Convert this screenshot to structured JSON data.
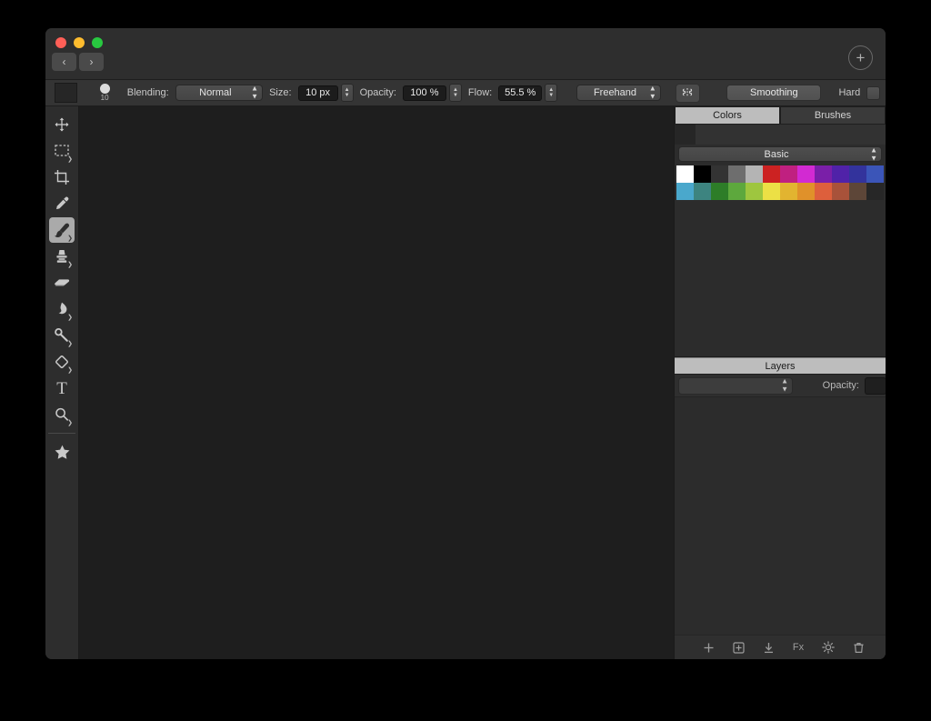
{
  "window": {
    "traffic_lights": [
      "close",
      "minimize",
      "maximize"
    ],
    "nav_back": "‹",
    "nav_forward": "›",
    "add_button": "+"
  },
  "options_bar": {
    "foreground_color": "#262626",
    "brush_size_label": "10",
    "blending_label": "Blending:",
    "blending_value": "Normal",
    "size_label": "Size:",
    "size_value": "10 px",
    "opacity_label": "Opacity:",
    "opacity_value": "100 %",
    "flow_label": "Flow:",
    "flow_value": "55.5 %",
    "stroke_mode_value": "Freehand",
    "symmetry_icon": "symmetry-icon",
    "smoothing_label": "Smoothing",
    "hard_label": "Hard",
    "hard_checked": false
  },
  "tools": [
    {
      "name": "move-tool",
      "icon": "move-icon",
      "active": false,
      "submenu": false
    },
    {
      "name": "rectangular-marquee-tool",
      "icon": "marquee-icon",
      "active": false,
      "submenu": true
    },
    {
      "name": "crop-tool",
      "icon": "crop-icon",
      "active": false,
      "submenu": false
    },
    {
      "name": "eyedropper-tool",
      "icon": "eyedropper-icon",
      "active": false,
      "submenu": false
    },
    {
      "name": "brush-tool",
      "icon": "brush-icon",
      "active": true,
      "submenu": true
    },
    {
      "name": "clone-stamp-tool",
      "icon": "stamp-icon",
      "active": false,
      "submenu": true
    },
    {
      "name": "eraser-tool",
      "icon": "eraser-icon",
      "active": false,
      "submenu": false
    },
    {
      "name": "smudge-tool",
      "icon": "smudge-icon",
      "active": false,
      "submenu": true
    },
    {
      "name": "dodge-tool",
      "icon": "dodge-icon",
      "active": false,
      "submenu": true
    },
    {
      "name": "paint-bucket-tool",
      "icon": "bucket-icon",
      "active": false,
      "submenu": true
    },
    {
      "name": "text-tool",
      "icon": "text-icon",
      "active": false,
      "submenu": false
    },
    {
      "name": "zoom-tool",
      "icon": "magnifier-icon",
      "active": false,
      "submenu": true
    },
    {
      "name": "favorites-tool",
      "icon": "star-icon",
      "active": false,
      "submenu": false
    }
  ],
  "right_panel": {
    "tabs": [
      {
        "label": "Colors",
        "active": true
      },
      {
        "label": "Brushes",
        "active": false
      }
    ],
    "current_color": "#262626",
    "palette_name": "Basic",
    "swatch_rows": [
      [
        "#ffffff",
        "#000000",
        "#333333",
        "#6e6e6e",
        "#b4b4b4",
        "#cc2222",
        "#c02080",
        "#d22ad2",
        "#7a1fa8",
        "#5022a8",
        "#33339c",
        "#3b55b8"
      ],
      [
        "#4aa8cc",
        "#3d8480",
        "#2d7d28",
        "#5da83d",
        "#9ec63f",
        "#ece045",
        "#e2b430",
        "#e0912a",
        "#dd5f3c",
        "#a8523a",
        "#5d4638",
        "#272727"
      ]
    ],
    "layers": {
      "header": "Layers",
      "blend_mode": "",
      "opacity_label": "Opacity:",
      "opacity_value": "",
      "items": [],
      "toolbar_icons": [
        {
          "name": "add-layer-icon",
          "glyph": "+"
        },
        {
          "name": "add-group-icon",
          "glyph": "⊞"
        },
        {
          "name": "merge-down-icon",
          "glyph": "⤓"
        },
        {
          "name": "effects-icon",
          "glyph": "Fx"
        },
        {
          "name": "adjustments-icon",
          "glyph": "☀"
        },
        {
          "name": "delete-layer-icon",
          "glyph": "🗑"
        }
      ]
    }
  }
}
